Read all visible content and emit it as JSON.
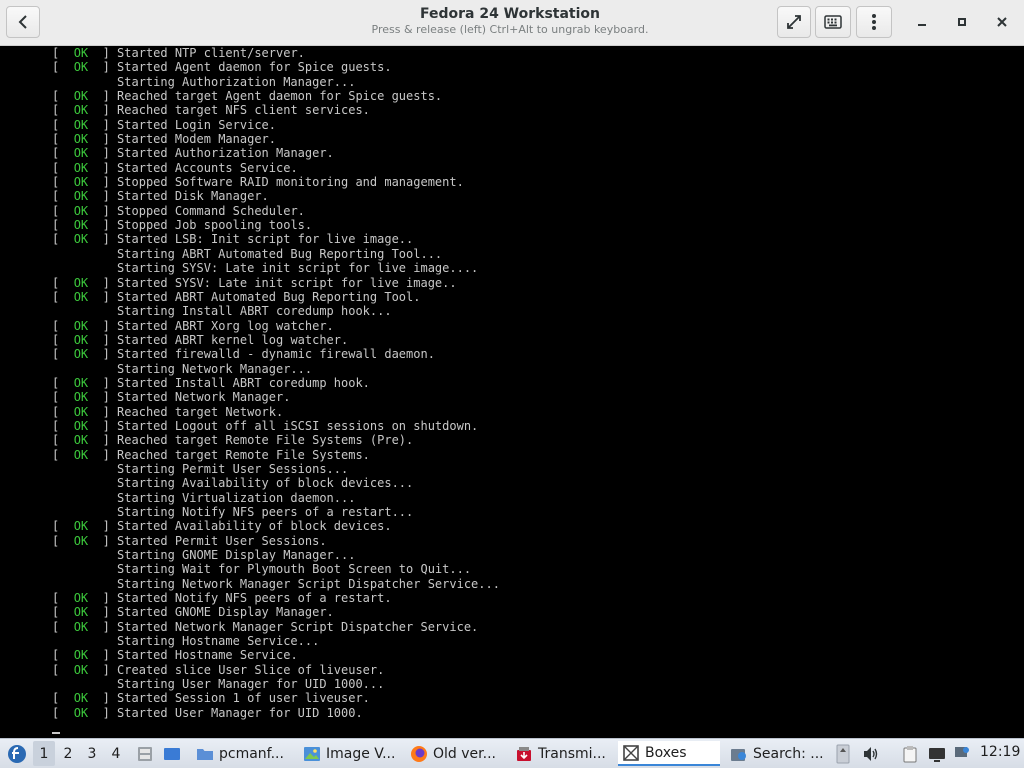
{
  "window": {
    "title": "Fedora 24 Workstation",
    "subtitle": "Press & release (left) Ctrl+Alt to ungrab keyboard."
  },
  "console": {
    "ok_label": "OK",
    "lines": [
      {
        "ok": true,
        "text": "Started NTP client/server."
      },
      {
        "ok": true,
        "text": "Started Agent daemon for Spice guests."
      },
      {
        "ok": false,
        "text": "Starting Authorization Manager..."
      },
      {
        "ok": true,
        "text": "Reached target Agent daemon for Spice guests."
      },
      {
        "ok": true,
        "text": "Reached target NFS client services."
      },
      {
        "ok": true,
        "text": "Started Login Service."
      },
      {
        "ok": true,
        "text": "Started Modem Manager."
      },
      {
        "ok": true,
        "text": "Started Authorization Manager."
      },
      {
        "ok": true,
        "text": "Started Accounts Service."
      },
      {
        "ok": true,
        "text": "Stopped Software RAID monitoring and management."
      },
      {
        "ok": true,
        "text": "Started Disk Manager."
      },
      {
        "ok": true,
        "text": "Stopped Command Scheduler."
      },
      {
        "ok": true,
        "text": "Stopped Job spooling tools."
      },
      {
        "ok": true,
        "text": "Started LSB: Init script for live image.."
      },
      {
        "ok": false,
        "text": "Starting ABRT Automated Bug Reporting Tool..."
      },
      {
        "ok": false,
        "text": "Starting SYSV: Late init script for live image...."
      },
      {
        "ok": true,
        "text": "Started SYSV: Late init script for live image.."
      },
      {
        "ok": true,
        "text": "Started ABRT Automated Bug Reporting Tool."
      },
      {
        "ok": false,
        "text": "Starting Install ABRT coredump hook..."
      },
      {
        "ok": true,
        "text": "Started ABRT Xorg log watcher."
      },
      {
        "ok": true,
        "text": "Started ABRT kernel log watcher."
      },
      {
        "ok": true,
        "text": "Started firewalld - dynamic firewall daemon."
      },
      {
        "ok": false,
        "text": "Starting Network Manager..."
      },
      {
        "ok": true,
        "text": "Started Install ABRT coredump hook."
      },
      {
        "ok": true,
        "text": "Started Network Manager."
      },
      {
        "ok": true,
        "text": "Reached target Network."
      },
      {
        "ok": true,
        "text": "Started Logout off all iSCSI sessions on shutdown."
      },
      {
        "ok": true,
        "text": "Reached target Remote File Systems (Pre)."
      },
      {
        "ok": true,
        "text": "Reached target Remote File Systems."
      },
      {
        "ok": false,
        "text": "Starting Permit User Sessions..."
      },
      {
        "ok": false,
        "text": "Starting Availability of block devices..."
      },
      {
        "ok": false,
        "text": "Starting Virtualization daemon..."
      },
      {
        "ok": false,
        "text": "Starting Notify NFS peers of a restart..."
      },
      {
        "ok": true,
        "text": "Started Availability of block devices."
      },
      {
        "ok": true,
        "text": "Started Permit User Sessions."
      },
      {
        "ok": false,
        "text": "Starting GNOME Display Manager..."
      },
      {
        "ok": false,
        "text": "Starting Wait for Plymouth Boot Screen to Quit..."
      },
      {
        "ok": false,
        "text": "Starting Network Manager Script Dispatcher Service..."
      },
      {
        "ok": true,
        "text": "Started Notify NFS peers of a restart."
      },
      {
        "ok": true,
        "text": "Started GNOME Display Manager."
      },
      {
        "ok": true,
        "text": "Started Network Manager Script Dispatcher Service."
      },
      {
        "ok": false,
        "text": "Starting Hostname Service..."
      },
      {
        "ok": true,
        "text": "Started Hostname Service."
      },
      {
        "ok": true,
        "text": "Created slice User Slice of liveuser."
      },
      {
        "ok": false,
        "text": "Starting User Manager for UID 1000..."
      },
      {
        "ok": true,
        "text": "Started Session 1 of user liveuser."
      },
      {
        "ok": true,
        "text": "Started User Manager for UID 1000."
      }
    ]
  },
  "taskbar": {
    "desktops": [
      "1",
      "2",
      "3",
      "4"
    ],
    "active_desktop": "1",
    "tasks": [
      {
        "label": "pcmanf...",
        "icon": "folder-icon"
      },
      {
        "label": "Image V...",
        "icon": "image-viewer-icon"
      },
      {
        "label": "Old ver...",
        "icon": "firefox-icon"
      },
      {
        "label": "Transmi...",
        "icon": "transmission-icon"
      },
      {
        "label": "Boxes",
        "icon": "boxes-icon"
      },
      {
        "label": "Search: ...",
        "icon": "search-tool-icon"
      }
    ],
    "clock": "12:19"
  },
  "colors": {
    "ok_green": "#3cc83c",
    "console_text": "#c8c8c8",
    "console_bg": "#000000",
    "titlebar_bg": "#ececec",
    "active_task_accent": "#3a86d8"
  }
}
